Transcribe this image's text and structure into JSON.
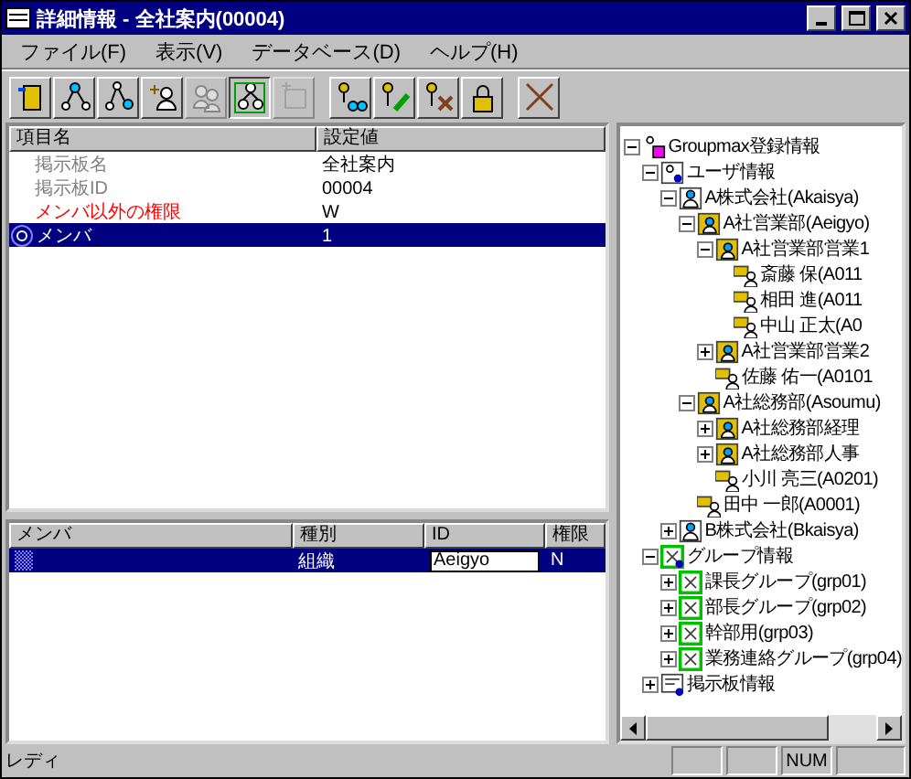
{
  "window": {
    "title": "詳細情報 - 全社案内(00004)"
  },
  "menu": [
    "ファイル(F)",
    "表示(V)",
    "データベース(D)",
    "ヘルプ(H)"
  ],
  "toolbar": [
    {
      "kind": "door",
      "disabled": false,
      "pressed": false
    },
    {
      "kind": "network",
      "disabled": false,
      "pressed": false
    },
    {
      "kind": "network-link",
      "disabled": false,
      "pressed": false
    },
    {
      "kind": "add-person",
      "disabled": false,
      "pressed": false
    },
    {
      "kind": "people",
      "disabled": true,
      "pressed": false
    },
    {
      "kind": "tree",
      "disabled": false,
      "pressed": true
    },
    {
      "kind": "frame",
      "disabled": true,
      "pressed": false
    },
    {
      "kind": "key-glasses",
      "disabled": false,
      "pressed": false
    },
    {
      "kind": "key-pen",
      "disabled": false,
      "pressed": false
    },
    {
      "kind": "key-x",
      "disabled": false,
      "pressed": false
    },
    {
      "kind": "lock",
      "disabled": false,
      "pressed": false
    },
    {
      "kind": "delete",
      "disabled": false,
      "pressed": false
    }
  ],
  "properties": {
    "columns": [
      "項目名",
      "設定値"
    ],
    "rows": [
      {
        "label": "掲示板名",
        "value": "全社案内",
        "color": "#808080",
        "selected": false
      },
      {
        "label": "掲示板ID",
        "value": "00004",
        "color": "#808080",
        "selected": false
      },
      {
        "label": "メンバ以外の権限",
        "value": "W",
        "color": "#ff0000",
        "selected": false
      },
      {
        "label": "メンバ",
        "value": "1",
        "selected": true,
        "icon": true
      }
    ]
  },
  "members": {
    "columns": [
      "メンバ",
      "種別",
      "ID",
      "権限"
    ],
    "rows": [
      {
        "type": "組織",
        "id": "Aeigyo",
        "permission": "N",
        "selected": true
      }
    ]
  },
  "tree": [
    {
      "label": "Groupmax登録情報",
      "kind": "root",
      "expanded": true,
      "children": [
        {
          "label": "ユーザ情報",
          "kind": "users",
          "expanded": true,
          "children": [
            {
              "label": "A株式会社(Akaisya)",
              "kind": "company",
              "expanded": true,
              "children": [
                {
                  "label": "A社営業部(Aeigyo)",
                  "kind": "dept",
                  "expanded": true,
                  "children": [
                    {
                      "label": "A社営業部営業1",
                      "kind": "dept",
                      "expanded": true,
                      "children": [
                        {
                          "label": "斎藤 保(A011",
                          "kind": "person"
                        },
                        {
                          "label": "相田 進(A011",
                          "kind": "person"
                        },
                        {
                          "label": "中山 正太(A0",
                          "kind": "person"
                        }
                      ]
                    },
                    {
                      "label": "A社営業部営業2",
                      "kind": "dept",
                      "expanded": false
                    },
                    {
                      "label": "佐藤 佑一(A0101",
                      "kind": "person"
                    }
                  ]
                },
                {
                  "label": "A社総務部(Asoumu)",
                  "kind": "dept",
                  "expanded": true,
                  "children": [
                    {
                      "label": "A社総務部経理",
                      "kind": "dept",
                      "expanded": false
                    },
                    {
                      "label": "A社総務部人事",
                      "kind": "dept",
                      "expanded": false
                    },
                    {
                      "label": "小川 亮三(A0201)",
                      "kind": "person"
                    }
                  ]
                },
                {
                  "label": "田中 一郎(A0001)",
                  "kind": "person"
                }
              ]
            },
            {
              "label": "B株式会社(Bkaisya)",
              "kind": "company",
              "expanded": false
            }
          ]
        },
        {
          "label": "グループ情報",
          "kind": "groups",
          "expanded": true,
          "children": [
            {
              "label": "課長グループ(grp01)",
              "kind": "group",
              "expanded": false
            },
            {
              "label": "部長グループ(grp02)",
              "kind": "group",
              "expanded": false
            },
            {
              "label": "幹部用(grp03)",
              "kind": "group",
              "expanded": false
            },
            {
              "label": "業務連絡グループ(grp04)",
              "kind": "group",
              "expanded": false
            }
          ]
        },
        {
          "label": "掲示板情報",
          "kind": "board",
          "expanded": false
        }
      ]
    }
  ],
  "status_bar": {
    "message": "レディ",
    "indicator": "NUM"
  }
}
